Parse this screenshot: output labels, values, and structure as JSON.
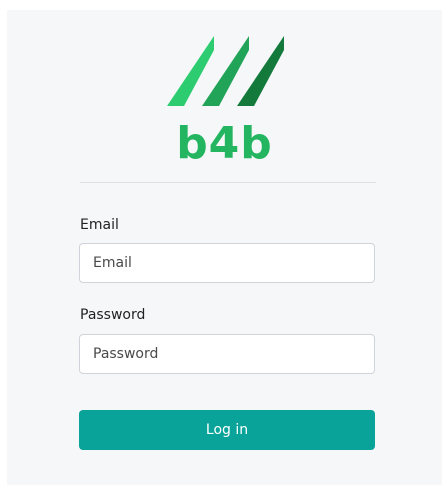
{
  "brand": {
    "name": "b4b",
    "logo_icon": "b4b-stripes-logo-icon",
    "colors": [
      "#2ecc71",
      "#21a358",
      "#137a3c"
    ]
  },
  "form": {
    "email_label": "Email",
    "email_placeholder": "Email",
    "email_value": "",
    "password_label": "Password",
    "password_placeholder": "Password",
    "password_value": "",
    "login_label": "Log in"
  },
  "colors": {
    "accent": "#0aa39a",
    "brand_text": "#23b55f",
    "panel_bg": "#f6f7f9"
  }
}
